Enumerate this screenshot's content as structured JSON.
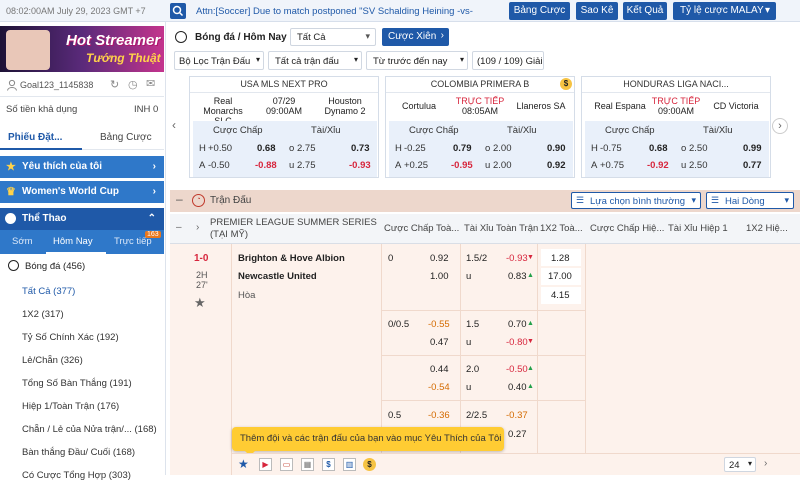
{
  "topbar": {
    "datetime": "08:02:00AM July 29, 2023 GMT +7",
    "notice": "Attn:[Soccer] Due to match postponed \"SV Schalding Heining -vs-",
    "buttons": [
      "Bảng Cược",
      "Sao Kê",
      "Kết Quả"
    ],
    "odds_type": "Tỷ lệ cược MALAY",
    "colors": {
      "primary": "#1f59a8",
      "accent": "#2f78c9"
    }
  },
  "banner": {
    "line1": "Hot Streamer",
    "line2": "Tướng Thuật"
  },
  "account": {
    "username": "Goal123_1145838",
    "balance_label": "Số tiền khả dụng",
    "balance_value": "INH 0"
  },
  "left_tabs": {
    "slip": "Phiếu Đặt...",
    "bets": "Bảng Cược"
  },
  "sections": {
    "favorites": "Yêu thích của tôi",
    "world_cup": "Women's World Cup",
    "sports": "Thể Thao"
  },
  "sport_tabs": {
    "early": "Sớm",
    "today": "Hôm Nay",
    "live": "Trực tiếp",
    "live_count": "163"
  },
  "sport": {
    "name": "Bóng đá",
    "count": "(456)"
  },
  "markets": [
    {
      "label": "Tất Cả",
      "count": "(377)",
      "active": true
    },
    {
      "label": "1X2",
      "count": "(317)"
    },
    {
      "label": "Tỷ Số Chính Xác",
      "count": "(192)"
    },
    {
      "label": "Lẻ/Chẵn",
      "count": "(326)"
    },
    {
      "label": "Tổng Số Bàn Thắng",
      "count": "(191)"
    },
    {
      "label": "Hiệp 1/Toàn Trận",
      "count": "(176)"
    },
    {
      "label": "Chẵn / Lẻ của Nửa trận/...",
      "count": "(168)"
    },
    {
      "label": "Bàn thắng Đầu/ Cuối",
      "count": "(168)"
    },
    {
      "label": "Có Cược Tổng Hợp",
      "count": "(303)"
    }
  ],
  "main_header": {
    "title": "Bóng đá / Hôm Nay",
    "filter_select": "Tất Cả",
    "parlay_button": "Cược Xiên"
  },
  "filters": {
    "league": "Bộ Lọc Trận Đấu",
    "match": "Tất cả trận đấu",
    "sort": "Từ trước đến nay",
    "pages": "(109 / 109) Giải"
  },
  "featured": [
    {
      "league": "USA MLS NEXT PRO",
      "home": "Real Monarchs SLC",
      "away": "Houston Dynamo 2",
      "time1": "07/29",
      "time2": "09:00AM",
      "live": false,
      "h_hcp": "+0.50",
      "h_odd": "0.68",
      "a_hcp": "-0.50",
      "a_odd": "-0.88",
      "o_line": "2.75",
      "o_odd": "0.73",
      "u_line": "2.75",
      "u_odd": "-0.93"
    },
    {
      "league": "COLOMBIA PRIMERA B",
      "home": "Cortulua",
      "away": "Llaneros SA",
      "time1": "TRỰC TIẾP",
      "time2": "08:05AM",
      "live": true,
      "h_hcp": "-0.25",
      "h_odd": "0.79",
      "a_hcp": "+0.25",
      "a_odd": "-0.95",
      "o_line": "2.00",
      "o_odd": "0.90",
      "u_line": "2.00",
      "u_odd": "0.92"
    },
    {
      "league": "HONDURAS LIGA NACI...",
      "home": "Real Espana",
      "away": "CD Victoria",
      "time1": "TRỰC TIẾP",
      "time2": "09:00AM",
      "live": true,
      "h_hcp": "-0.75",
      "h_odd": "0.68",
      "a_hcp": "+0.75",
      "a_odd": "-0.92",
      "o_line": "2.50",
      "o_odd": "0.99",
      "u_line": "2.50",
      "u_odd": "0.77"
    }
  ],
  "featured_labels": {
    "hcp": "Cược Chấp",
    "ou": "Tài/Xỉu",
    "h": "H",
    "a": "A",
    "o": "o",
    "u": "u"
  },
  "match_bar": {
    "title": "Trận Đấu",
    "view": "Lựa chọn bình thường",
    "lines": "Hai Dòng"
  },
  "columns": {
    "league": "PREMIER LEAGUE SUMMER SERIES (TẠI MỸ)",
    "hcp_ft": "Cược Chấp Toà...",
    "ou_ft": "Tài Xỉu Toàn Trận",
    "x12_ft": "1X2 Toà...",
    "hcp_1h": "Cược Chấp Hiệ...",
    "ou_1h": "Tài Xỉu Hiệp 1",
    "x12_1h": "1X2 Hiệ..."
  },
  "match": {
    "score": "1-0",
    "period": "2H",
    "minute": "27'",
    "home": "Brighton & Hove Albion",
    "away": "Newcastle United",
    "draw": "Hòa"
  },
  "odds_rows": [
    {
      "h_hcp": "0",
      "h_odd": "0.92",
      "a_odd": "1.00",
      "ou_line": "1.5/2",
      "o_odd": "-0.93",
      "u_odd": "0.83",
      "x1": "1.28",
      "x2": "17.00",
      "xd": "4.15"
    },
    {
      "h_hcp": "0/0.5",
      "h_odd": "-0.55",
      "a_odd": "0.47",
      "ou_line": "1.5",
      "o_odd": "0.70",
      "u_odd": "-0.80"
    },
    {
      "h_hcp": "",
      "h_odd": "0.44",
      "a_odd": "-0.54",
      "ou_line": "2.0",
      "o_odd": "-0.50",
      "u_odd": "0.40"
    },
    {
      "h_hcp": "0.5",
      "h_odd": "-0.36",
      "a_odd": "",
      "ou_line": "2/2.5",
      "o_odd": "-0.37",
      "u_odd": "0.27"
    }
  ],
  "tooltip": "Thêm đội và các trận đấu của bạn vào mục Yêu Thích của Tôi",
  "page_size": "24"
}
